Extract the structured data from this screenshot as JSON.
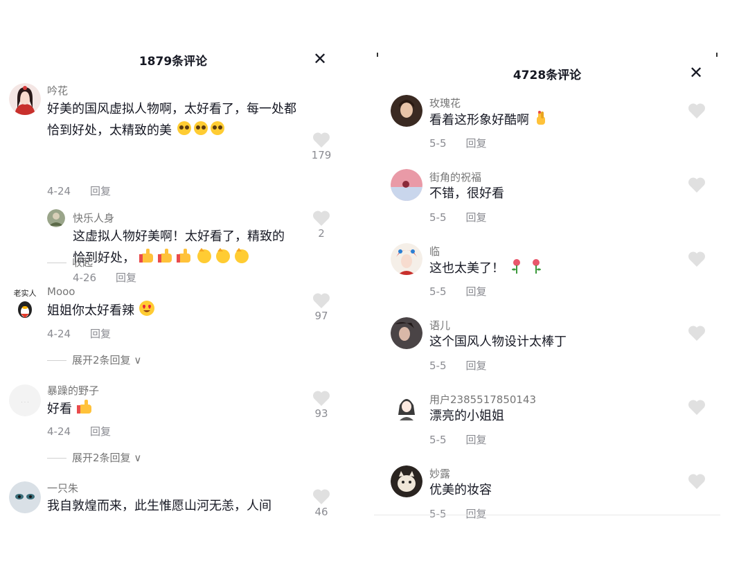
{
  "left_panel": {
    "title": "1879条评论",
    "close": "✕",
    "comments": [
      {
        "name": "吟花",
        "text": "好美的国风虚拟人物啊，太好看了，每一处都恰到好处，太精致的美",
        "date": "4-24",
        "reply": "回复",
        "likes": "179",
        "replies": [
          {
            "name": "快乐人身",
            "text": "这虚拟人物好美啊！太好看了，精致的恰到好处，",
            "date": "4-26",
            "reply": "回复",
            "likes": "2"
          }
        ],
        "collapse": "收起"
      },
      {
        "name": "Mooo",
        "avatar_text": "老实人",
        "text": "姐姐你太好看辣",
        "date": "4-24",
        "reply": "回复",
        "likes": "97",
        "expand": "展开2条回复"
      },
      {
        "name": "暴躁的野子",
        "text": "好看",
        "date": "4-24",
        "reply": "回复",
        "likes": "93",
        "expand": "展开2条回复"
      },
      {
        "name": "一只朱",
        "text": "我自敦煌而来，此生惟愿山河无恙，人间",
        "likes": "46"
      }
    ]
  },
  "right_panel": {
    "title": "4728条评论",
    "close": "✕",
    "comments": [
      {
        "name": "玫瑰花",
        "text": "看着这形象好酷啊",
        "date": "5-5",
        "reply": "回复"
      },
      {
        "name": "街角的祝福",
        "text": "不错，很好看",
        "date": "5-5",
        "reply": "回复"
      },
      {
        "name": "临",
        "text": "这也太美了！",
        "date": "5-5",
        "reply": "回复"
      },
      {
        "name": "语儿",
        "text": "这个国风人物设计太棒丁",
        "date": "5-5",
        "reply": "回复"
      },
      {
        "name": "用户2385517850143",
        "text": "漂亮的小姐姐",
        "date": "5-5",
        "reply": "回复"
      },
      {
        "name": "妙露",
        "text": "优美的妆容",
        "date": "5-5",
        "reply": "回复"
      }
    ]
  },
  "colors": {
    "text": "#161823",
    "secondary": "#8a8b91",
    "heart": "#e0e0e0"
  }
}
